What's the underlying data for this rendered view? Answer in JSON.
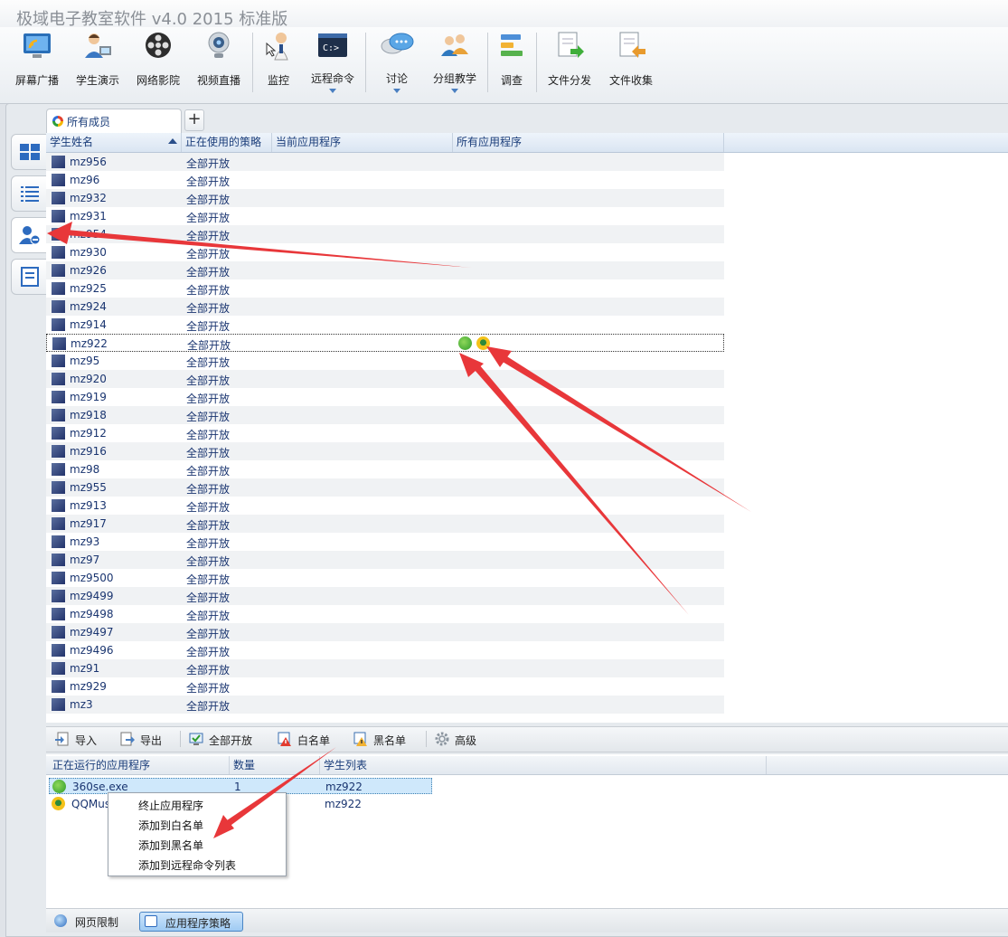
{
  "window": {
    "title": "极域电子教室软件 v4.0 2015 标准版"
  },
  "toolbar": {
    "screen_broadcast": "屏幕广播",
    "student_demo": "学生演示",
    "network_video": "网络影院",
    "video_live": "视频直播",
    "monitor": "监控",
    "remote_command": "远程命令",
    "discussion": "讨论",
    "group_teaching": "分组教学",
    "survey": "调查",
    "file_distribute": "文件分发",
    "file_collect": "文件收集"
  },
  "tabs": {
    "all_members": "所有成员",
    "add": "+"
  },
  "grid": {
    "columns": [
      "学生姓名",
      "正在使用的策略",
      "当前应用程序",
      "所有应用程序"
    ],
    "policy_value": "全部开放",
    "rows": [
      "mz956",
      "mz96",
      "mz932",
      "mz931",
      "mz954",
      "mz930",
      "mz926",
      "mz925",
      "mz924",
      "mz914",
      "mz922",
      "mz95",
      "mz920",
      "mz919",
      "mz918",
      "mz912",
      "mz916",
      "mz98",
      "mz955",
      "mz913",
      "mz917",
      "mz93",
      "mz97",
      "mz9500",
      "mz9499",
      "mz9498",
      "mz9497",
      "mz9496",
      "mz91",
      "mz929",
      "mz3"
    ],
    "selected_row": "mz922"
  },
  "bottom_toolbar": {
    "import": "导入",
    "export": "导出",
    "all_open": "全部开放",
    "whitelist": "白名单",
    "blacklist": "黑名单",
    "advanced": "高级"
  },
  "app_grid": {
    "columns": [
      "正在运行的应用程序",
      "数量",
      "学生列表"
    ],
    "rows": [
      {
        "app": "360se.exe",
        "count": "1",
        "students": "mz922"
      },
      {
        "app": "QQMus",
        "count": "",
        "students": "mz922"
      }
    ]
  },
  "context_menu": {
    "items": [
      "终止应用程序",
      "添加到白名单",
      "添加到黑名单",
      "添加到远程命令列表"
    ]
  },
  "statusbar": {
    "web_limit": "网页限制",
    "app_policy": "应用程序策略"
  },
  "colors": {
    "annotation_arrow": "#e8373a",
    "selection": "#cfe8fb",
    "accent": "#2a4f8a"
  }
}
